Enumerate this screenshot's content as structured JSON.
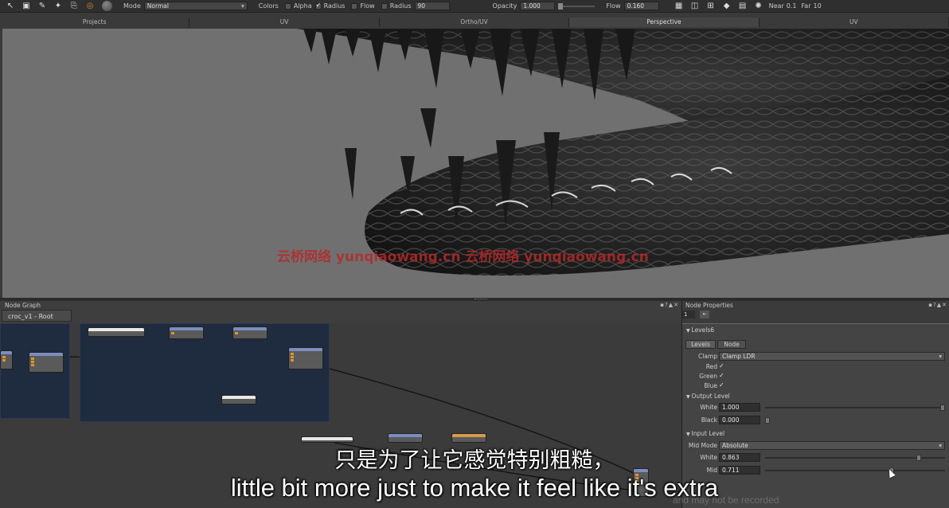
{
  "toolbar": {
    "mode_label": "Mode",
    "mode_value": "Normal",
    "colors_label": "Colors",
    "alpha_label": "Alpha",
    "radius_label": "Radius",
    "flow_label": "Flow",
    "radius2_label": "Radius",
    "radius2_value": "90",
    "opacity_label": "Opacity",
    "opacity_value": "1.000",
    "flow2_label": "Flow",
    "flow2_value": "0.160",
    "near_label": "Near",
    "near_value": "0.1",
    "far_label": "Far",
    "far_value": "10"
  },
  "tabs": [
    "Projects",
    "UV",
    "Ortho/UV",
    "Perspective",
    "UV"
  ],
  "active_tab": 3,
  "watermark": "云桥网络 yunqiaowang.cn 云桥网络 yunqiaowang.cn",
  "node_graph": {
    "title": "Node Graph",
    "tab": "croc_v1 - Root"
  },
  "properties": {
    "title": "Node Properties",
    "page": "1",
    "node_name": "Levels6",
    "subtabs": [
      "Levels",
      "Node"
    ],
    "clamp_label": "Clamp",
    "clamp_value": "Clamp LDR",
    "red_label": "Red",
    "green_label": "Green",
    "blue_label": "Blue",
    "output_level": "Output Level",
    "white_label": "White",
    "white_value": "1.000",
    "black_label": "Black",
    "black_value": "0.000",
    "input_level": "Input Level",
    "mid_mode_label": "Mid Mode",
    "mid_mode_value": "Absolute",
    "in_white_label": "White",
    "in_white_value": "0.863",
    "mid_label": "Mid",
    "mid_value": "0.711",
    "in_white_level": 0.863,
    "mid_level": 0.711
  },
  "subtitles": {
    "cn": "只是为了让它感觉特别粗糙，",
    "en": "little bit more just to make it feel like it's extra"
  },
  "ghost_text": "and may not be recorded",
  "colors": {
    "accent_orange": "#e08a2a",
    "node_header": "#7b8dc2",
    "backdrop": "#1f2b3e",
    "watermark": "#b42a2a"
  }
}
